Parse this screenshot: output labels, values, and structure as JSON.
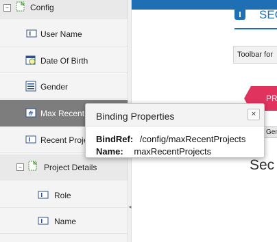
{
  "tree": {
    "root": {
      "label": "Config",
      "toggle": "–"
    },
    "fields": [
      {
        "label": "User Name",
        "icon": "text-field-icon"
      },
      {
        "label": "Date Of Birth",
        "icon": "date-field-icon"
      },
      {
        "label": "Gender",
        "icon": "list-field-icon"
      },
      {
        "label": "Max Recent P",
        "icon": "number-field-icon",
        "selected": true
      },
      {
        "label": "Recent Projec",
        "icon": "text-field-icon"
      }
    ],
    "group": {
      "label": "Project Details",
      "toggle": "–"
    },
    "group_fields": [
      {
        "label": "Role",
        "icon": "text-field-icon"
      },
      {
        "label": "Name",
        "icon": "text-field-icon"
      }
    ],
    "splitter_glyph": "◂"
  },
  "right": {
    "section_title": "SEC",
    "toolbar_label": "Toolbar for",
    "pr_button": "PR",
    "gene_button": "Gene",
    "section_heading": "Sec"
  },
  "popup": {
    "title": "Binding Properties",
    "close": "×",
    "bindref_label": "BindRef:",
    "bindref_value": "/config/maxRecentProjects",
    "name_label": "Name:",
    "name_value": "maxRecentProjects"
  },
  "colors": {
    "accent": "#1f6fb5",
    "pr_button": "#e0345e",
    "selected_row": "#7d7d7d"
  }
}
